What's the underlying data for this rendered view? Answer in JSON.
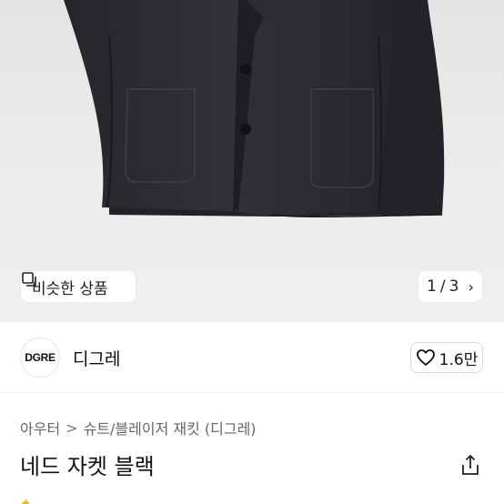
{
  "gallery": {
    "similar_label": "비슷한 상품",
    "page_current": "1",
    "page_separator": "/",
    "page_total": "3"
  },
  "seller": {
    "logo_text": "DGRE",
    "name": "디그레",
    "likes": "1.6만"
  },
  "breadcrumb": {
    "items": [
      "아우터",
      "슈트/블레이저 재킷 (디그레)"
    ],
    "separator": ">"
  },
  "product": {
    "title": "네드 자켓 블랙"
  },
  "colors": {
    "jacket": "#2b2b2e",
    "background": "#e8e8e8",
    "star": "#f5b400"
  }
}
